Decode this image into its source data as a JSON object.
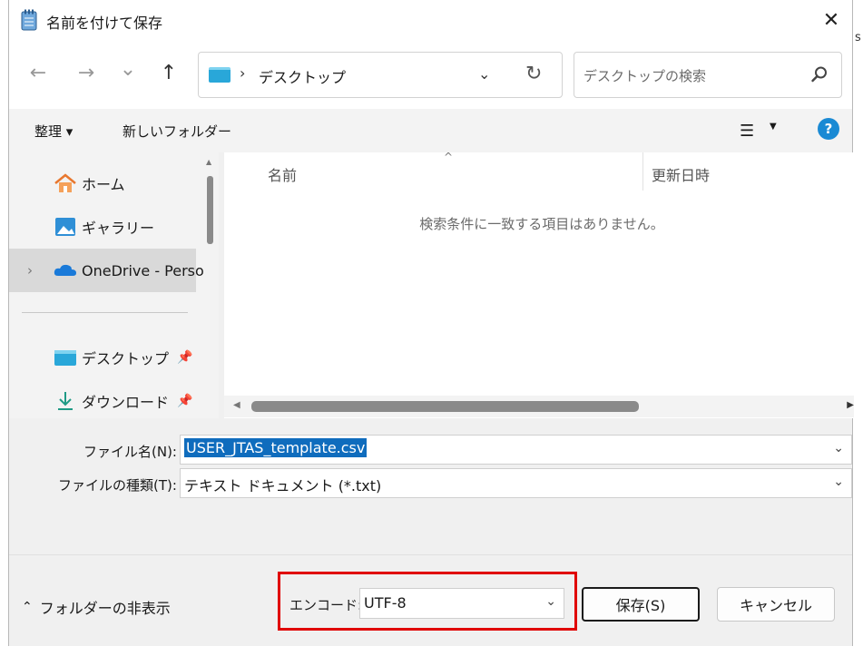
{
  "window": {
    "title": "名前を付けて保存",
    "close_glyph": "✕"
  },
  "nav": {
    "back": "←",
    "forward": "→",
    "recent": "⌄",
    "up": "↑",
    "address": {
      "separator": "›",
      "location": "デスクトップ"
    },
    "search_placeholder": "デスクトップの検索"
  },
  "commands": {
    "organize": "整理 ▾",
    "new_folder": "新しいフォルダー",
    "view_glyph": "☰",
    "view_drop": "▼",
    "help": "?"
  },
  "sidebar": {
    "items": [
      {
        "label": "ホーム"
      },
      {
        "label": "ギャラリー"
      },
      {
        "label": "OneDrive - Perso"
      },
      {
        "label": "デスクトップ"
      },
      {
        "label": "ダウンロード"
      }
    ]
  },
  "content": {
    "columns": [
      "名前",
      "更新日時"
    ],
    "empty_message": "検索条件に一致する項目はありません。"
  },
  "fields": {
    "filename_label": "ファイル名(N):",
    "filename_value": "USER_JTAS_template.csv",
    "filetype_label": "ファイルの種類(T):",
    "filetype_value": "テキスト ドキュメント (*.txt)"
  },
  "bottom": {
    "hide_folders": "フォルダーの非表示",
    "encoding_label": "エンコード:",
    "encoding_value": "UTF-8",
    "save_label": "保存(S)",
    "cancel_label": "キャンセル"
  },
  "colors": {
    "accent": "#0f6cbd",
    "highlight_box": "#e00000",
    "selected_row": "#d9d9d9"
  }
}
